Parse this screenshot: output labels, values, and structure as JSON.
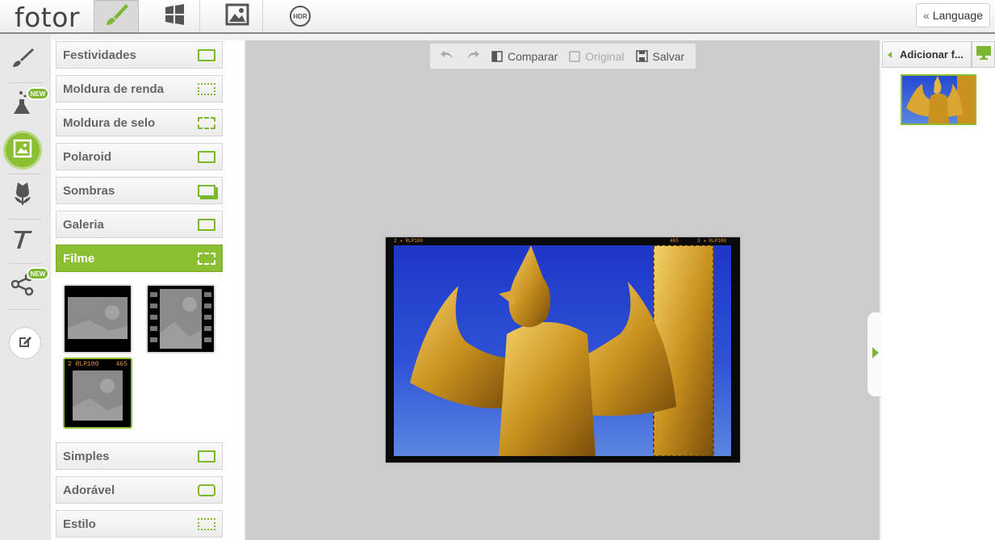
{
  "app": {
    "logo": "fotor"
  },
  "topnav": {
    "tabs": [
      {
        "icon": "brush-icon",
        "active": true
      },
      {
        "icon": "collage-icon",
        "active": false
      },
      {
        "icon": "picture-icon",
        "active": false
      },
      {
        "icon": "hdr-icon",
        "label": "HDR",
        "active": false
      }
    ],
    "language_label": "Language"
  },
  "tools": [
    {
      "icon": "brush-icon"
    },
    {
      "icon": "flask-icon",
      "badge": "NEW"
    },
    {
      "icon": "frame-icon",
      "active": true
    },
    {
      "icon": "tulip-icon"
    },
    {
      "icon": "text-icon"
    },
    {
      "icon": "share-icon",
      "badge": "NEW"
    },
    {
      "icon": "edit-square-icon"
    }
  ],
  "categories": [
    {
      "label": "Festividades"
    },
    {
      "label": "Moldura de renda"
    },
    {
      "label": "Moldura de selo"
    },
    {
      "label": "Polaroid"
    },
    {
      "label": "Sombras"
    },
    {
      "label": "Galeria"
    },
    {
      "label": "Filme",
      "active": true
    },
    {
      "label": "Simples"
    },
    {
      "label": "Adorável"
    },
    {
      "label": "Estilo"
    }
  ],
  "film_thumbs": {
    "third_label_left": "2  RLP100",
    "third_label_right": "465"
  },
  "toolbar": {
    "compare_label": "Comparar",
    "original_label": "Original",
    "save_label": "Salvar"
  },
  "photo_frame": {
    "label_left": "2 ◂ RLP100",
    "label_mid": "465",
    "label_right": "3 ◂ RLP100"
  },
  "right_panel": {
    "add_photo_label": "Adicionar f..."
  },
  "colors": {
    "accent": "#8bbe32",
    "canvas_bg": "#cccccc"
  }
}
